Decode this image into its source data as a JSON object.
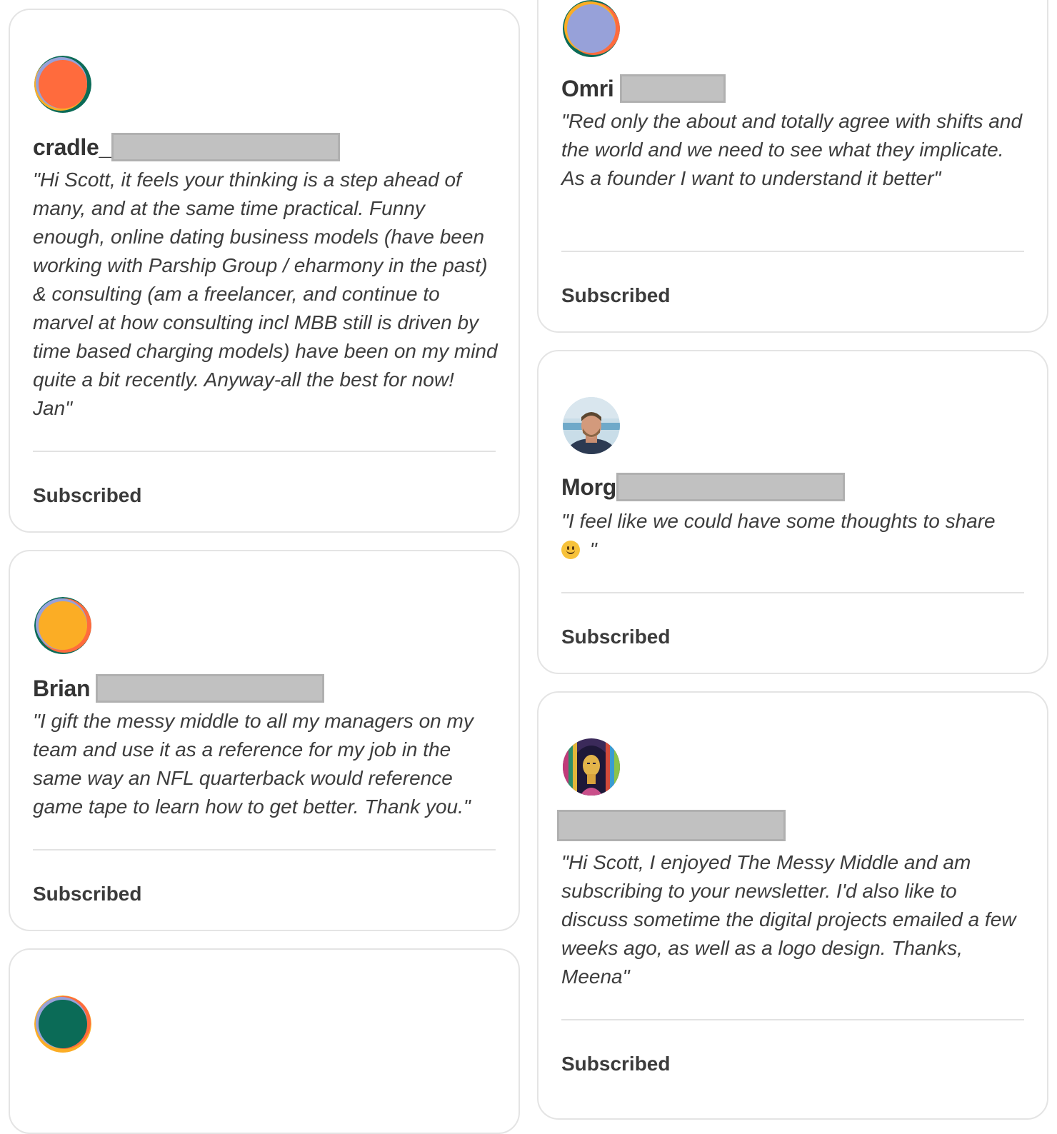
{
  "cards": [
    {
      "name": "cradle_",
      "quote": "\"Hi Scott, it feels your thinking is a step ahead of many, and at the same time practical. Funny enough, online dating business models (have been working with Parship Group / eharmony in the past) & consulting (am a freelancer, and continue to marvel at how consulting incl MBB still is driven by time based charging models) have been on my mind quite a bit recently. Anyway-all the best for now! Jan\"",
      "status": "Subscribed",
      "avatar_color": "#ff6b3d"
    },
    {
      "name": "Brian",
      "quote": "\"I gift the messy middle to all my managers on my team and use it as a reference for my job in the same way an NFL quarterback would reference game tape to learn how to get better. Thank you.\"",
      "status": "Subscribed",
      "avatar_color": "#fbad25"
    },
    {
      "name": "",
      "avatar_color": "#0b6b57"
    },
    {
      "name": "Omri",
      "quote": "\"Red only the about and totally agree with shifts and the world and we need to see what they implicate. As a founder I want to understand it better\"",
      "status": "Subscribed",
      "avatar_color": "#97a1d9"
    },
    {
      "name": "Morg",
      "quote": "\"I feel like we could have some thoughts to share",
      "quote_end": " \"",
      "emoji": "slightly-smiling-face",
      "status": "Subscribed",
      "avatar": "photo-man-beach"
    },
    {
      "name": "",
      "quote": "\"Hi Scott, I enjoyed The Messy Middle and am subscribing to your newsletter. I'd also like to discuss sometime the digital projects emailed a few weeks ago, as well as a logo design. Thanks, Meena\"",
      "status": "Subscribed",
      "avatar": "artistic-portrait-woman"
    }
  ],
  "colors": {
    "orange": "#ff6b3d",
    "yellow": "#fbad25",
    "green": "#0b6b57",
    "lavender": "#97a1d9",
    "redaction": "#c1c1c1"
  }
}
